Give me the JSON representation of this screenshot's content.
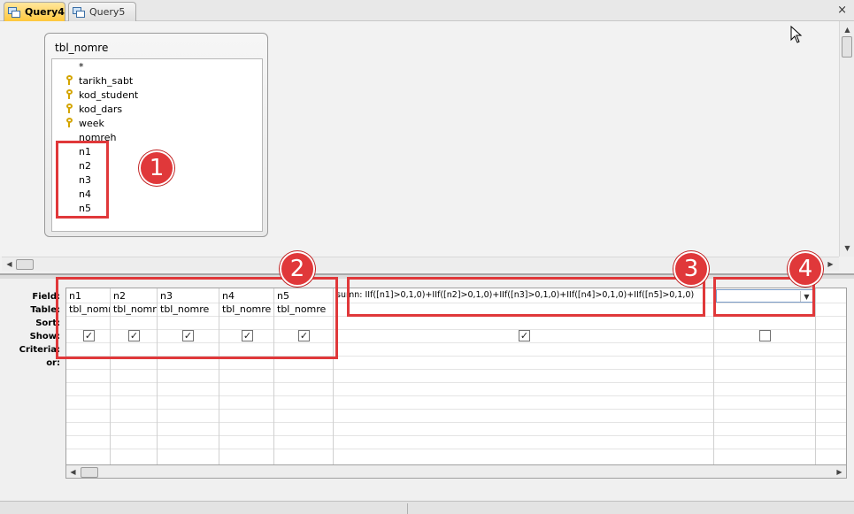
{
  "tabs": [
    {
      "label": "Query4",
      "active": true
    },
    {
      "label": "Query5",
      "active": false
    }
  ],
  "close_glyph": "×",
  "table_box": {
    "title": "tbl_nomre",
    "fields": [
      {
        "name": "*",
        "key": false
      },
      {
        "name": "tarikh_sabt",
        "key": true
      },
      {
        "name": "kod_student",
        "key": true
      },
      {
        "name": "kod_dars",
        "key": true
      },
      {
        "name": "week",
        "key": true
      },
      {
        "name": "nomreh",
        "key": false
      },
      {
        "name": "n1",
        "key": false
      },
      {
        "name": "n2",
        "key": false
      },
      {
        "name": "n3",
        "key": false
      },
      {
        "name": "n4",
        "key": false
      },
      {
        "name": "n5",
        "key": false
      }
    ]
  },
  "grid": {
    "row_labels": [
      "Field:",
      "Table:",
      "Sort:",
      "Show:",
      "Criteria:",
      "or:"
    ],
    "columns": [
      {
        "field": "n1",
        "table": "tbl_nomre",
        "show": true
      },
      {
        "field": "n2",
        "table": "tbl_nomre",
        "show": true
      },
      {
        "field": "n3",
        "table": "tbl_nomre",
        "show": true
      },
      {
        "field": "n4",
        "table": "tbl_nomre",
        "show": true
      },
      {
        "field": "n5",
        "table": "tbl_nomre",
        "show": true
      },
      {
        "field": "sumn: IIf([n1]>0,1,0)+IIf([n2]>0,1,0)+IIf([n3]>0,1,0)+IIf([n4]>0,1,0)+IIf([n5]>0,1,0)",
        "table": "",
        "show": true
      },
      {
        "field": "",
        "table": "",
        "show": false
      }
    ]
  },
  "badges": [
    "1",
    "2",
    "3",
    "4"
  ],
  "colors": {
    "annotation": "#e0383a",
    "active_tab": "#ffc83d"
  },
  "icons": {
    "key": "primary-key-icon",
    "checkmark": "✓",
    "dropdown": "chevron-down-icon"
  }
}
